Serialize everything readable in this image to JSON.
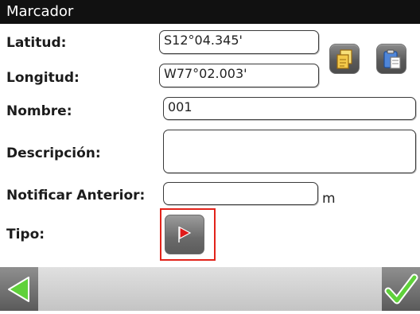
{
  "window": {
    "title": "Marcador"
  },
  "fields": {
    "latitude": {
      "label": "Latitud:",
      "value": "S12°04.345'"
    },
    "longitude": {
      "label": "Longitud:",
      "value": "W77°02.003'"
    },
    "name": {
      "label": "Nombre:",
      "value": "001"
    },
    "description": {
      "label": "Descripción:",
      "value": ""
    },
    "notify_previous": {
      "label": "Notificar Anterior:",
      "value": "",
      "unit": "m"
    },
    "type": {
      "label": "Tipo:",
      "icon": "red-flag-icon"
    }
  },
  "toolbar": {
    "copy_icon": "copy-icon",
    "paste_icon": "paste-icon",
    "back_icon": "back-arrow-icon",
    "confirm_icon": "checkmark-icon"
  },
  "colors": {
    "titlebar": "#111111",
    "highlight": "#e2231a",
    "arrow_green": "#5fd13a",
    "flag_red": "#e01b1b"
  }
}
